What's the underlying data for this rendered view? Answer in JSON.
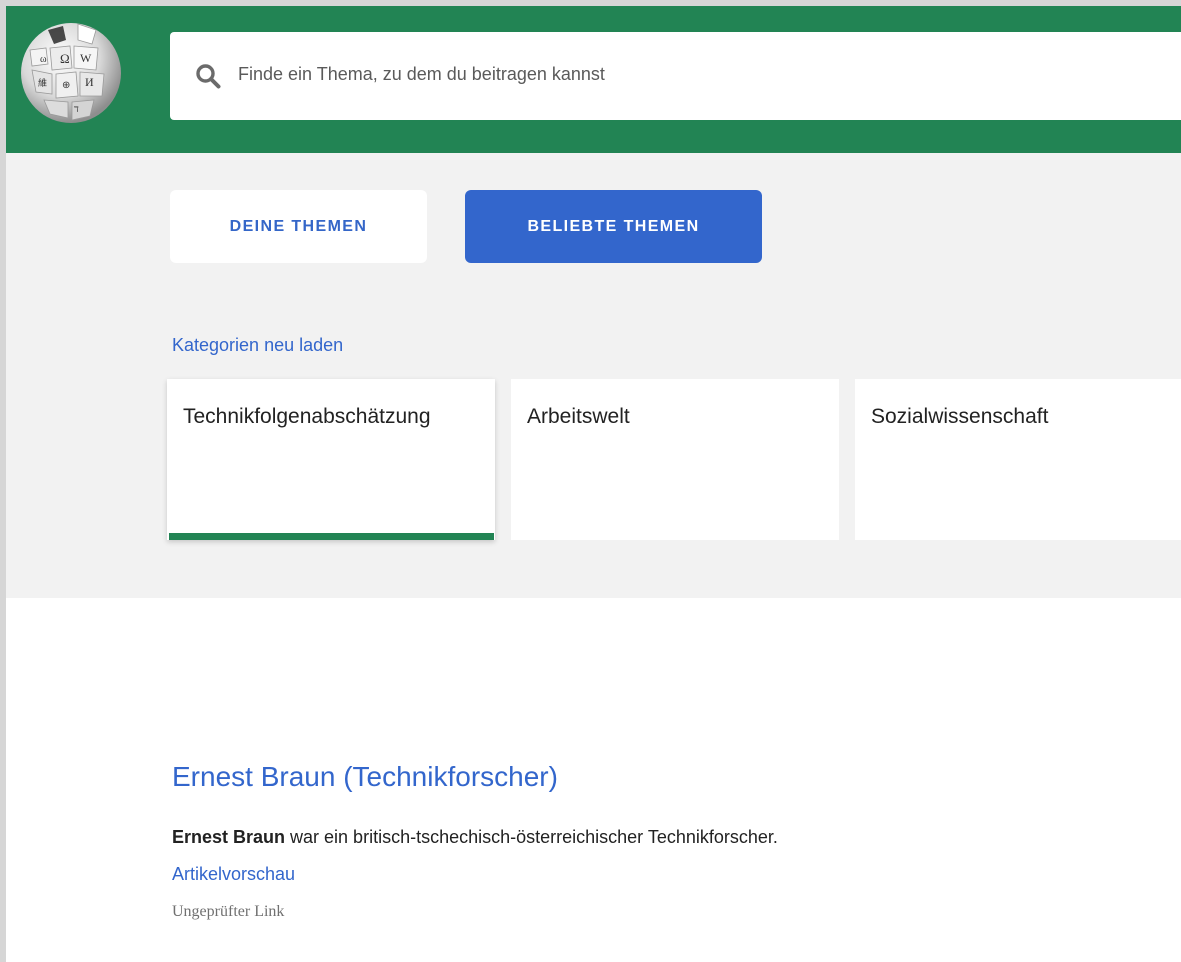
{
  "header": {
    "logo_icon": "wikipedia-globe-logo-icon",
    "background_color": "#228454",
    "search": {
      "icon": "search-icon",
      "placeholder": "Finde ein Thema, zu dem du beitragen kannst"
    }
  },
  "tabs": [
    {
      "label": "DEINE THEMEN",
      "selected": false
    },
    {
      "label": "BELIEBTE THEMEN",
      "selected": true
    }
  ],
  "accent_color": "#3366cc",
  "reload_link": "Kategorien neu laden",
  "categories": [
    {
      "label": "Technikfolgenabschätzung",
      "selected": true
    },
    {
      "label": "Arbeitswelt",
      "selected": false
    },
    {
      "label": "Sozialwissenschaft",
      "selected": false
    }
  ],
  "article": {
    "title": "Ernest Braun (Technikforscher)",
    "description_bold": "Ernest Braun",
    "description_rest": " war ein britisch-tschechisch-österreichischer Technikforscher.",
    "preview_link": "Artikelvorschau",
    "status": "Ungeprüfter Link"
  }
}
